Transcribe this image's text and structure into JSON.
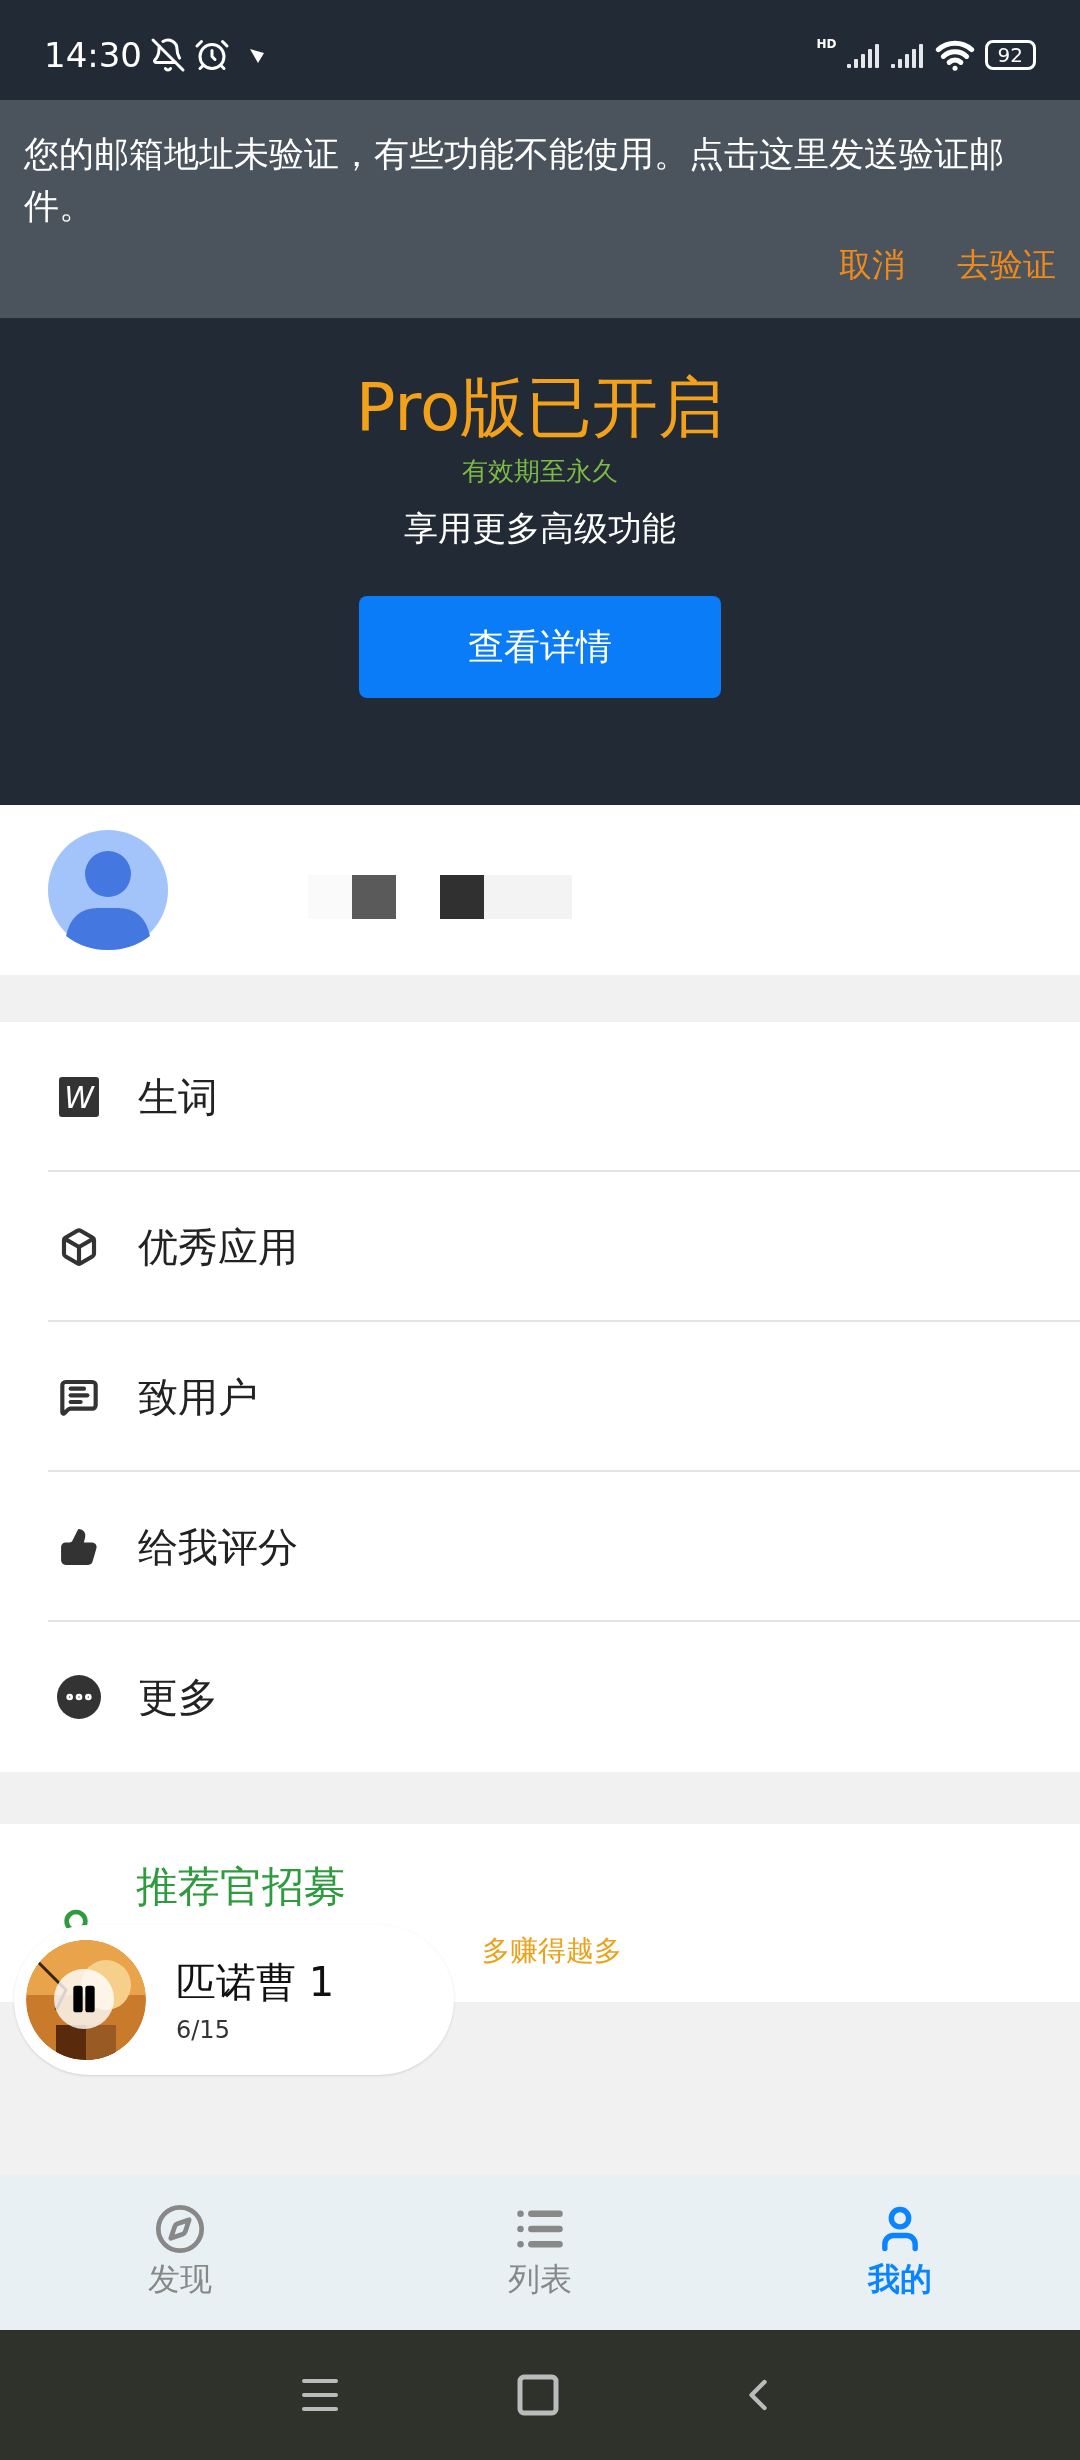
{
  "status_bar": {
    "time": "14:30",
    "battery": "92",
    "network_label": "HD"
  },
  "notice": {
    "message": "您的邮箱地址未验证，有些功能不能使用。点击这里发送验证邮件。",
    "actions": [
      {
        "label": "取消"
      },
      {
        "label": "去验证"
      }
    ]
  },
  "pro": {
    "title": "Pro版已开启",
    "validity": "有效期至永久",
    "tagline": "享用更多高级功能",
    "button": "查看详情"
  },
  "menu": [
    {
      "kind": "words",
      "label": "生词",
      "badge": "W"
    },
    {
      "kind": "apps",
      "label": "优秀应用"
    },
    {
      "kind": "message",
      "label": "致用户"
    },
    {
      "kind": "rate",
      "label": "给我评分"
    },
    {
      "kind": "more",
      "label": "更多"
    }
  ],
  "recruit": {
    "title": "推荐官招募",
    "subtitle": "多赚得越多"
  },
  "player": {
    "title": "匹诺曹 1",
    "progress": "6/15",
    "playing": true
  },
  "bottom_nav": [
    {
      "kind": "discover",
      "label": "发现",
      "selected": false
    },
    {
      "kind": "list",
      "label": "列表",
      "selected": false
    },
    {
      "kind": "me",
      "label": "我的",
      "selected": true
    }
  ]
}
